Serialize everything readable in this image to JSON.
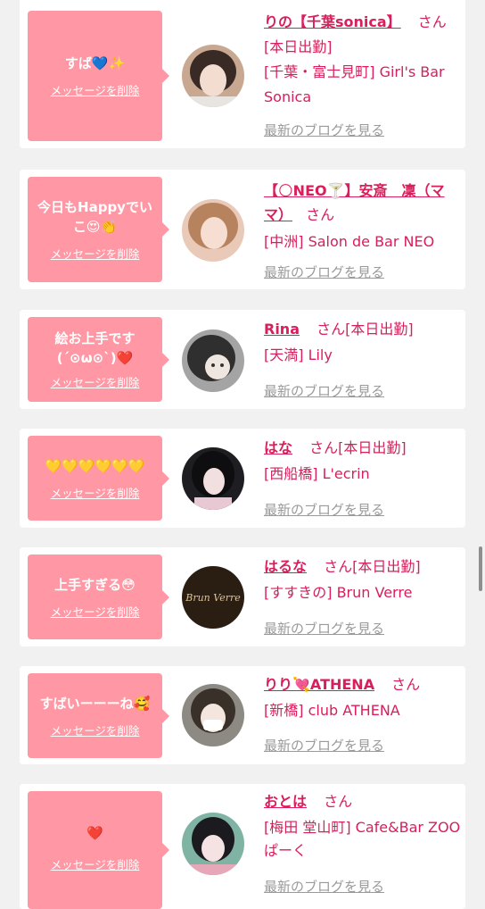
{
  "colors": {
    "bubble": "#ff98a4",
    "accent": "#d81e5b",
    "link_gray": "#9a9a9a",
    "background": "#f1f1f1"
  },
  "messages": [
    {
      "text": "すば💙✨",
      "delete_label": "メッセージを削除",
      "name": "りの【千葉sonica】",
      "suffix": "さん",
      "status": "",
      "shop": "[本日出勤]\n[千葉・富士見町] Girl's Bar Sonica",
      "blog_label": "最新のブログを見る"
    },
    {
      "text": "今日もHappyでいこ😍👏",
      "delete_label": "メッセージを削除",
      "name": "【🌕NEO🍸】安斎　凜（ママ）",
      "suffix": "さん",
      "status": "",
      "shop": "[中洲] Salon de Bar NEO",
      "blog_label": "最新のブログを見る"
    },
    {
      "text": "絵お上手です\n(´⊙ω⊙`)❤️",
      "delete_label": "メッセージを削除",
      "name": "Rina",
      "suffix": "さん",
      "status": "[本日出勤]",
      "shop": "[天満] Lily",
      "blog_label": "最新のブログを見る"
    },
    {
      "text": "💛💛💛💛💛💛",
      "delete_label": "メッセージを削除",
      "name": "はな",
      "suffix": "さん",
      "status": "[本日出勤]",
      "shop": "[西船橋] L'ecrin",
      "blog_label": "最新のブログを見る"
    },
    {
      "text": "上手すぎる😳",
      "delete_label": "メッセージを削除",
      "name": "はるな",
      "suffix": "さん",
      "status": "[本日出勤]",
      "shop": "[すすきの] Brun Verre",
      "blog_label": "最新のブログを見る",
      "avatar_text": "Brun Verre"
    },
    {
      "text": "すばいーーーね🥰",
      "delete_label": "メッセージを削除",
      "name": "りり💘ATHENA",
      "suffix": "さん",
      "status": "",
      "shop": "[新橋] club ATHENA",
      "blog_label": "最新のブログを見る"
    },
    {
      "text": "❤️",
      "delete_label": "メッセージを削除",
      "name": "おとは",
      "suffix": "さん",
      "status": "",
      "shop": "[梅田 堂山町] Cafe&Bar ZOOぱーく",
      "blog_label": "最新のブログを見る"
    }
  ]
}
